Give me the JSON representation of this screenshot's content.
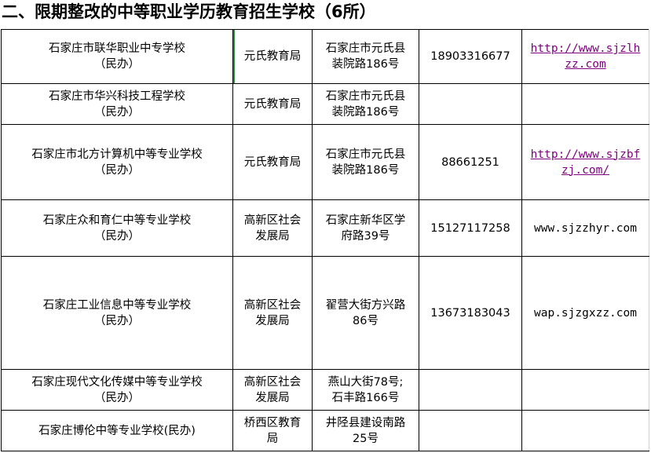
{
  "heading": "二、限期整改的中等职业学历教育招生学校（6所）",
  "rows": [
    {
      "name": [
        "石家庄市联华职业中专学校",
        "（民办）"
      ],
      "authority": [
        "元氏教育局"
      ],
      "address": [
        "石家庄市元氏县",
        "装院路186号"
      ],
      "phone": "18903316677",
      "website": [
        "http://www.sjzlh",
        "zz.com"
      ],
      "link": true
    },
    {
      "name": [
        "石家庄市华兴科技工程学校",
        "（民办）"
      ],
      "authority": [
        "元氏教育局"
      ],
      "address": [
        "石家庄市元氏县",
        "装院路186号"
      ],
      "phone": "",
      "website": [
        "",
        ""
      ],
      "link": false
    },
    {
      "name": [
        "石家庄市北方计算机中等专业学校",
        "（民办）"
      ],
      "authority": [
        "元氏教育局"
      ],
      "address": [
        "石家庄市元氏县",
        "装院路186号"
      ],
      "phone": "88661251",
      "website": [
        "http://www.sjzbf",
        "zj.com/"
      ],
      "link": true
    },
    {
      "name": [
        "石家庄众和育仁中等专业学校",
        "（民办）"
      ],
      "authority": [
        "高新区社会",
        "发展局"
      ],
      "address": [
        "石家庄新华区学",
        "府路39号"
      ],
      "phone": "15127117258",
      "website": [
        "www.sjzzhyr.com",
        ""
      ],
      "link": false
    },
    {
      "name": [
        "石家庄工业信息中等专业学校",
        "（民办）"
      ],
      "authority": [
        "高新区社会",
        "发展局"
      ],
      "address": [
        "翟营大街方兴路",
        "86号"
      ],
      "phone": "13673183043",
      "website": [
        "wap.sjzgxzz.com",
        ""
      ],
      "link": false
    },
    {
      "name": [
        "石家庄现代文化传媒中等专业学校",
        "（民办）"
      ],
      "authority": [
        "高新区社会",
        "发展局"
      ],
      "address": [
        "燕山大街78号;",
        "石丰路166号"
      ],
      "phone": "",
      "website": [
        "",
        ""
      ],
      "link": false
    },
    {
      "name": [
        "石家庄博伦中等专业学校(民办)",
        ""
      ],
      "authority": [
        "桥西区教育",
        "局"
      ],
      "address": [
        "井陉县建设南路",
        "25号"
      ],
      "phone": "",
      "website": [
        "",
        ""
      ],
      "link": false
    }
  ]
}
